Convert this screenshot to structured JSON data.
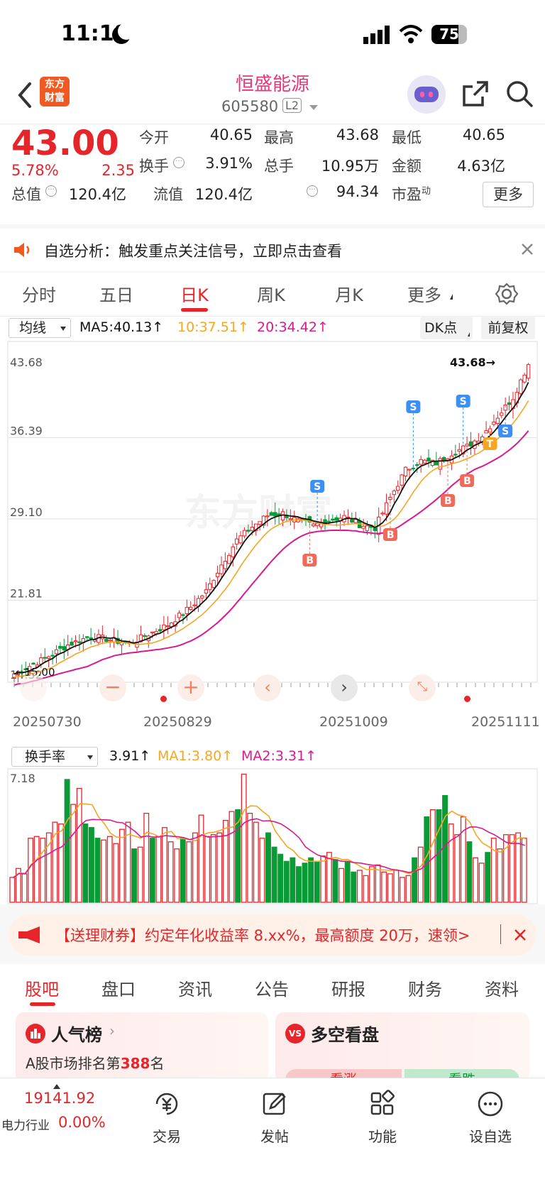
{
  "status": {
    "time": "11:18",
    "battery": "75"
  },
  "header": {
    "back": "<",
    "logo_line1": "东方",
    "logo_line2": "财富",
    "title": "恒盛能源",
    "code": "605580",
    "level": "L2"
  },
  "quote": {
    "price": "43.00",
    "pct": "5.78%",
    "chg": "2.35",
    "fields": [
      {
        "label": "今开",
        "value": "40.65"
      },
      {
        "label": "最高",
        "value": "43.68"
      },
      {
        "label": "最低",
        "value": "40.65"
      },
      {
        "label": "换手",
        "value": "3.91%"
      },
      {
        "label": "总手",
        "value": "10.95万"
      },
      {
        "label": "金额",
        "value": "4.63亿"
      },
      {
        "label": "总值",
        "value": "120.4亿"
      },
      {
        "label": "流值",
        "value": "120.4亿"
      },
      {
        "label": "市盈",
        "sup": "动",
        "value": "94.34"
      }
    ],
    "more": "更多"
  },
  "notice": {
    "text": "自选分析：触发重点关注信号，立即点击查看"
  },
  "tabs": [
    "分时",
    "五日",
    "日K",
    "周K",
    "月K",
    "更多"
  ],
  "active_tab": 2,
  "kline": {
    "ma_select": "均线",
    "ma5": "MA5:40.13",
    "ma10": "10:37.51",
    "ma20": "20:34.42",
    "dk": "DK点",
    "adjust": "前复权",
    "y_labels": [
      "43.68",
      "36.39",
      "29.10",
      "21.81",
      "14.52"
    ],
    "max_marker": "43.68",
    "min_marker": "15.00",
    "dates": [
      "20250730",
      "20250829",
      "20251009",
      "20251111"
    ],
    "watermark": "东方财富"
  },
  "volume": {
    "select": "换手率",
    "value": "3.91",
    "ma1": "MA1:3.80",
    "ma2": "MA2:3.31",
    "top_label": "7.18"
  },
  "ad": {
    "text": "【送理财券】约定年化收益率 8.xx%，最高额度 20万，速领>"
  },
  "bottom_tabs": [
    "股吧",
    "盘口",
    "资讯",
    "公告",
    "研报",
    "财务",
    "资料"
  ],
  "cards": {
    "popular": {
      "title": "人气榜",
      "desc_prefix": "A股市场排名第",
      "rank": "388",
      "desc_suffix": "名"
    },
    "duokong": {
      "title": "多空看盘",
      "up": "看涨",
      "down": "看跌"
    }
  },
  "footer": {
    "index_value": "19141.92",
    "index_name": "电力行业",
    "index_pct": "0.00%",
    "items": [
      "交易",
      "发帖",
      "功能",
      "设自选"
    ]
  },
  "colors": {
    "up": "#e5252a",
    "down": "#0a9b37",
    "ma5": "#111111",
    "ma10": "#f5a623",
    "ma20": "#d81b8c"
  }
}
